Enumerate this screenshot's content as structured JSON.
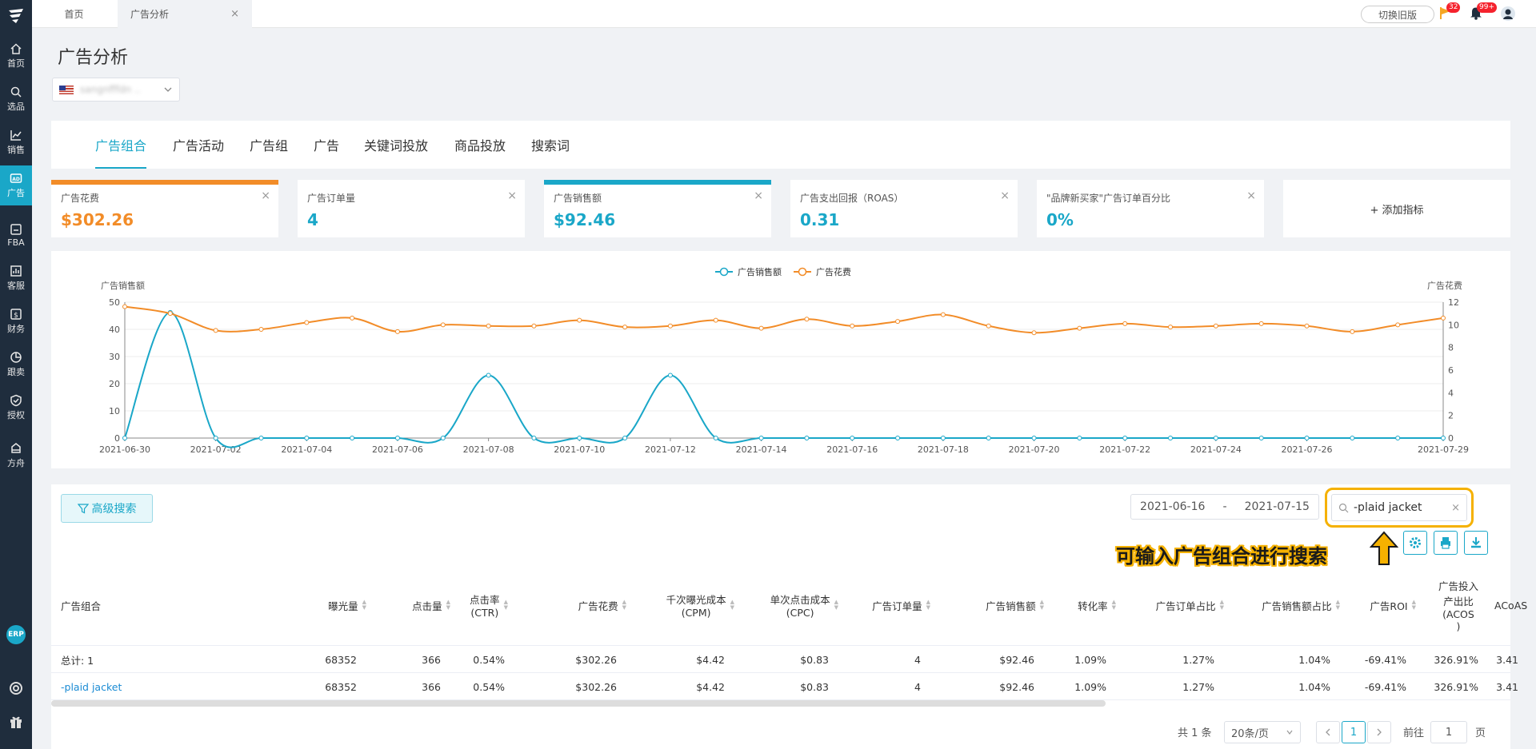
{
  "sidebar": {
    "items": [
      {
        "label": "首页",
        "icon": "home-icon"
      },
      {
        "label": "选品",
        "icon": "search-icon"
      },
      {
        "label": "销售",
        "icon": "chart-icon"
      },
      {
        "label": "广告",
        "icon": "ad-icon"
      },
      {
        "label": "FBA",
        "icon": "box-icon"
      },
      {
        "label": "客服",
        "icon": "service-icon"
      },
      {
        "label": "财务",
        "icon": "finance-icon"
      },
      {
        "label": "跟卖",
        "icon": "pie-icon"
      },
      {
        "label": "授权",
        "icon": "shield-icon"
      },
      {
        "label": "方舟",
        "icon": "ark-icon"
      }
    ],
    "erp": "ERP"
  },
  "topbar": {
    "home_tab": "首页",
    "current_tab": "广告分析",
    "old_version": "切换旧版",
    "flag_count": "32",
    "bell_count": "99+"
  },
  "page": {
    "title": "广告分析",
    "shop": "sangnfffdn ..",
    "tabs": [
      "广告组合",
      "广告活动",
      "广告组",
      "广告",
      "关键词投放",
      "商品投放",
      "搜索词"
    ]
  },
  "metrics": [
    {
      "label": "广告花费",
      "value": "$302.26",
      "color": "#f28c28"
    },
    {
      "label": "广告订单量",
      "value": "4",
      "color": "#1aa7c8"
    },
    {
      "label": "广告销售额",
      "value": "$92.46",
      "color": "#1aa7c8"
    },
    {
      "label": "广告支出回报（ROAS）",
      "value": "0.31",
      "color": "#1aa7c8"
    },
    {
      "label": "\"品牌新买家\"广告订单百分比",
      "value": "0%",
      "color": "#1aa7c8"
    }
  ],
  "add_metric": "+ 添加指标",
  "chart_data": {
    "type": "line",
    "x": [
      "2021-06-30",
      "2021-07-01",
      "2021-07-02",
      "2021-07-03",
      "2021-07-04",
      "2021-07-05",
      "2021-07-06",
      "2021-07-07",
      "2021-07-08",
      "2021-07-09",
      "2021-07-10",
      "2021-07-11",
      "2021-07-12",
      "2021-07-13",
      "2021-07-14",
      "2021-07-15",
      "2021-07-16",
      "2021-07-17",
      "2021-07-18",
      "2021-07-19",
      "2021-07-20",
      "2021-07-21",
      "2021-07-22",
      "2021-07-23",
      "2021-07-24",
      "2021-07-25",
      "2021-07-26",
      "2021-07-27",
      "2021-07-28",
      "2021-07-29"
    ],
    "x_ticks": [
      "2021-06-30",
      "2021-07-02",
      "2021-07-04",
      "2021-07-06",
      "2021-07-08",
      "2021-07-10",
      "2021-07-12",
      "2021-07-14",
      "2021-07-16",
      "2021-07-18",
      "2021-07-20",
      "2021-07-22",
      "2021-07-24",
      "2021-07-26",
      "2021-07-29"
    ],
    "series": [
      {
        "name": "广告销售额",
        "axis": "left",
        "color": "#1aa7c8",
        "values": [
          0,
          46.2,
          0,
          0,
          0,
          0,
          0,
          0,
          23.1,
          0,
          0,
          0,
          23.1,
          0,
          0,
          0,
          0,
          0,
          0,
          0,
          0,
          0,
          0,
          0,
          0,
          0,
          0,
          0,
          0,
          0
        ]
      },
      {
        "name": "广告花费",
        "axis": "right",
        "color": "#f28c28",
        "values": [
          11.6,
          11.0,
          9.5,
          9.6,
          10.2,
          10.6,
          9.4,
          10.0,
          9.9,
          9.9,
          10.4,
          9.8,
          9.9,
          10.4,
          9.7,
          10.5,
          9.9,
          10.3,
          10.9,
          9.9,
          9.3,
          9.7,
          10.1,
          9.8,
          9.9,
          10.1,
          9.9,
          9.4,
          10.0,
          10.6
        ]
      }
    ],
    "ylabel_left": "广告销售额",
    "ylabel_right": "广告花费",
    "ylim_left": [
      0,
      50
    ],
    "ylim_right": [
      0,
      12
    ],
    "yticks_left": [
      "0",
      "10",
      "20",
      "30",
      "40",
      "50"
    ],
    "yticks_right": [
      "0",
      "2",
      "4",
      "6",
      "8",
      "10",
      "12"
    ],
    "legend": "top-center",
    "grid": true
  },
  "table": {
    "adv_search": "高级搜索",
    "date_start": "2021-06-16",
    "date_sep": "-",
    "date_end": "2021-07-15",
    "search_value": "-plaid jacket",
    "hint": "可输入广告组合进行搜索",
    "headers": [
      "广告组合",
      "曝光量",
      "点击量",
      "点击率\n(CTR)",
      "广告花费",
      "千次曝光成本\n(CPM)",
      "单次点击成本\n(CPC)",
      "广告订单量",
      "广告销售额",
      "转化率",
      "广告订单占比",
      "广告销售额占比",
      "广告ROI",
      "广告投入\n产出比\n(ACOS\n)",
      "ACoAS"
    ],
    "total_row": [
      "总计: 1",
      "68352",
      "366",
      "0.54%",
      "$302.26",
      "$4.42",
      "$0.83",
      "4",
      "$92.46",
      "1.09%",
      "1.27%",
      "1.04%",
      "-69.41%",
      "326.91%",
      "3.41"
    ],
    "rows": [
      [
        "-plaid jacket",
        "68352",
        "366",
        "0.54%",
        "$302.26",
        "$4.42",
        "$0.83",
        "4",
        "$92.46",
        "1.09%",
        "1.27%",
        "1.04%",
        "-69.41%",
        "326.91%",
        "3.41"
      ]
    ]
  },
  "pagination": {
    "total": "共 1 条",
    "page_size": "20条/页",
    "current": "1",
    "goto_label": "前往",
    "goto_value": "1",
    "page_unit": "页"
  }
}
